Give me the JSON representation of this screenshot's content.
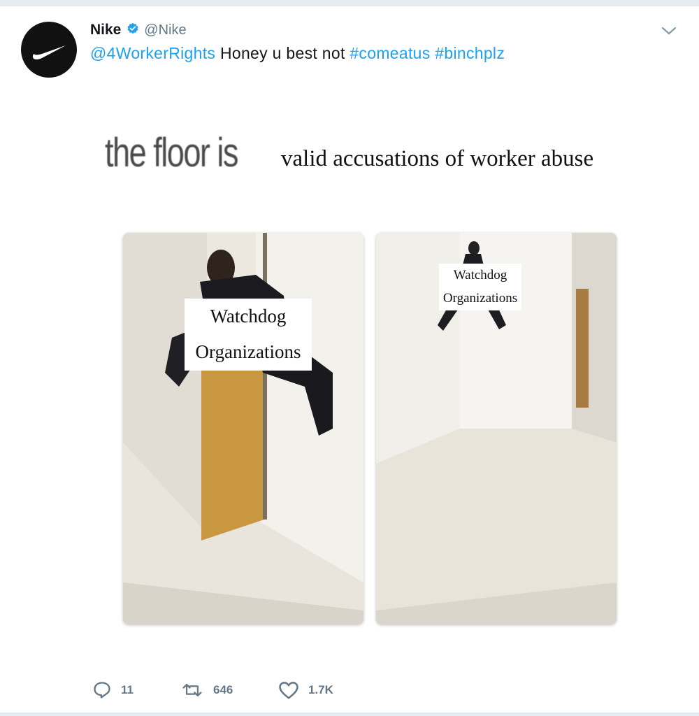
{
  "tweet": {
    "display_name": "Nike",
    "handle": "@Nike",
    "avatar_icon": "nike-swoosh-logo",
    "verified_icon": "verified-badge-icon",
    "menu_icon": "chevron-down-icon",
    "mention": "@4WorkerRights",
    "body_text": "Honey u best not",
    "hashtags": [
      "#comeatus",
      "#binchplz"
    ],
    "link_color": "#1da1f2"
  },
  "meme": {
    "title_left": "the floor is",
    "title_right": "valid accusations of worker abuse",
    "panel1_label_line1": "Watchdog",
    "panel1_label_line2": "Organizations",
    "panel2_label_line1": "Watchdog",
    "panel2_label_line2": "Organizations"
  },
  "actions": {
    "reply": {
      "icon": "reply-icon",
      "count": "11"
    },
    "retweet": {
      "icon": "retweet-icon",
      "count": "646"
    },
    "like": {
      "icon": "heart-icon",
      "count": "1.7K"
    }
  }
}
